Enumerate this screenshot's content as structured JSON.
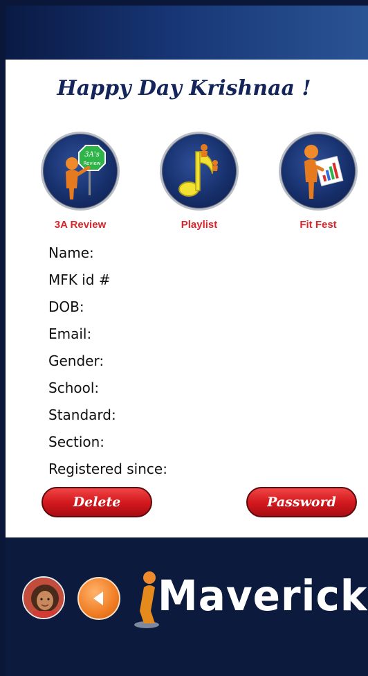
{
  "greeting": "Happy Day Krishnaa !",
  "features": [
    {
      "label": "3A Review",
      "icon": "review-sign-figure-icon",
      "badge": "3A's Review"
    },
    {
      "label": "Playlist",
      "icon": "music-note-icon"
    },
    {
      "label": "Fit Fest",
      "icon": "chart-board-figure-icon"
    }
  ],
  "profile": {
    "name": "Name:",
    "mfk_id": "MFK id #",
    "dob": "DOB:",
    "email": "Email:",
    "gender": "Gender:",
    "school": "School:",
    "standard": "Standard:",
    "section": "Section:",
    "registered_since": "Registered since:"
  },
  "buttons": {
    "delete": "Delete",
    "password": "Password"
  },
  "logo": {
    "text": "Maverick",
    "accent": "#e58a1c"
  },
  "colors": {
    "brand_navy": "#0c1a3e",
    "label_red": "#d8262b",
    "button_red": "#d41a1f"
  }
}
